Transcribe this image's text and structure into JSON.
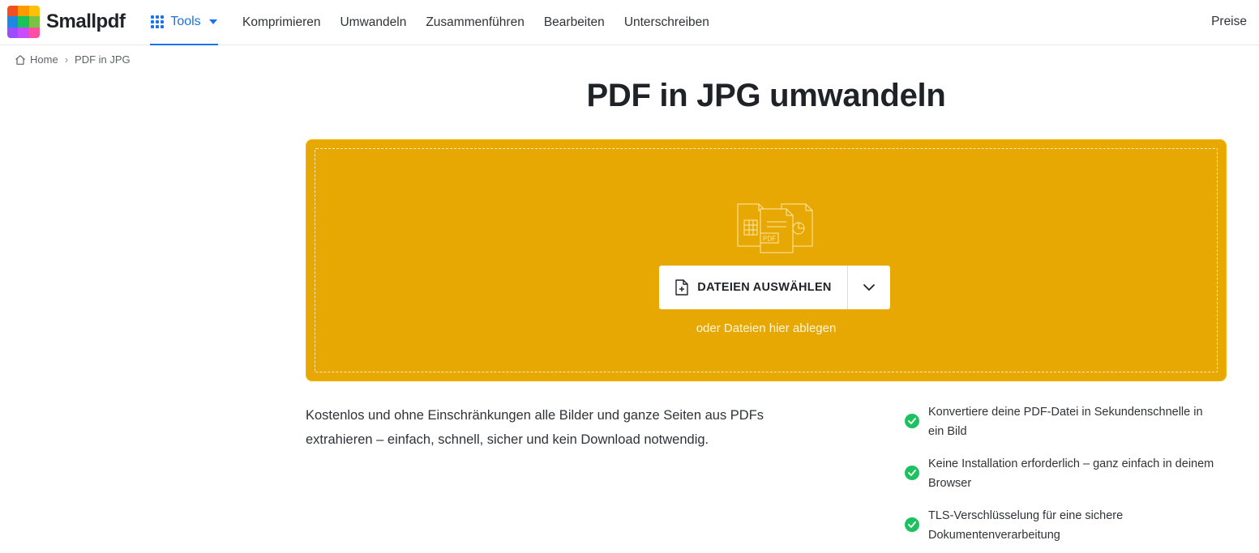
{
  "brand": {
    "name": "Smallpdf",
    "colors": [
      "#f25022",
      "#ff9900",
      "#ffc107",
      "#1e88e5",
      "#18c35a",
      "#7cc242",
      "#9c4dff",
      "#c84bff",
      "#ff4fa3"
    ]
  },
  "nav": {
    "tools_label": "Tools",
    "links": [
      "Komprimieren",
      "Umwandeln",
      "Zusammenführen",
      "Bearbeiten",
      "Unterschreiben"
    ],
    "pricing_label": "Preise",
    "accent_color": "#1a73e8"
  },
  "breadcrumb": {
    "home": "Home",
    "separator": "›",
    "current": "PDF in JPG"
  },
  "main": {
    "title": "PDF in JPG umwandeln",
    "dropzone": {
      "background_color": "#e8a803",
      "choose_button_label": "DATEIEN AUSWÄHLEN",
      "drop_hint": "oder Dateien hier ablegen",
      "illustration_badge": "PDF"
    },
    "description_lines": [
      "Kostenlos und ohne Einschränkungen alle Bilder und ganze Seiten aus PDFs",
      "extrahieren – einfach, schnell, sicher und kein Download notwendig."
    ],
    "features": [
      {
        "line1": "Konvertiere deine PDF-Datei in Sekundenschnelle in",
        "line2": "ein Bild"
      },
      {
        "line1": "Keine Installation erforderlich – ganz einfach in deinem",
        "line2": "Browser"
      },
      {
        "line1": "TLS-Verschlüsselung für eine sichere",
        "line2": "Dokumentenverarbeitung"
      }
    ],
    "check_color": "#1ec15f"
  }
}
